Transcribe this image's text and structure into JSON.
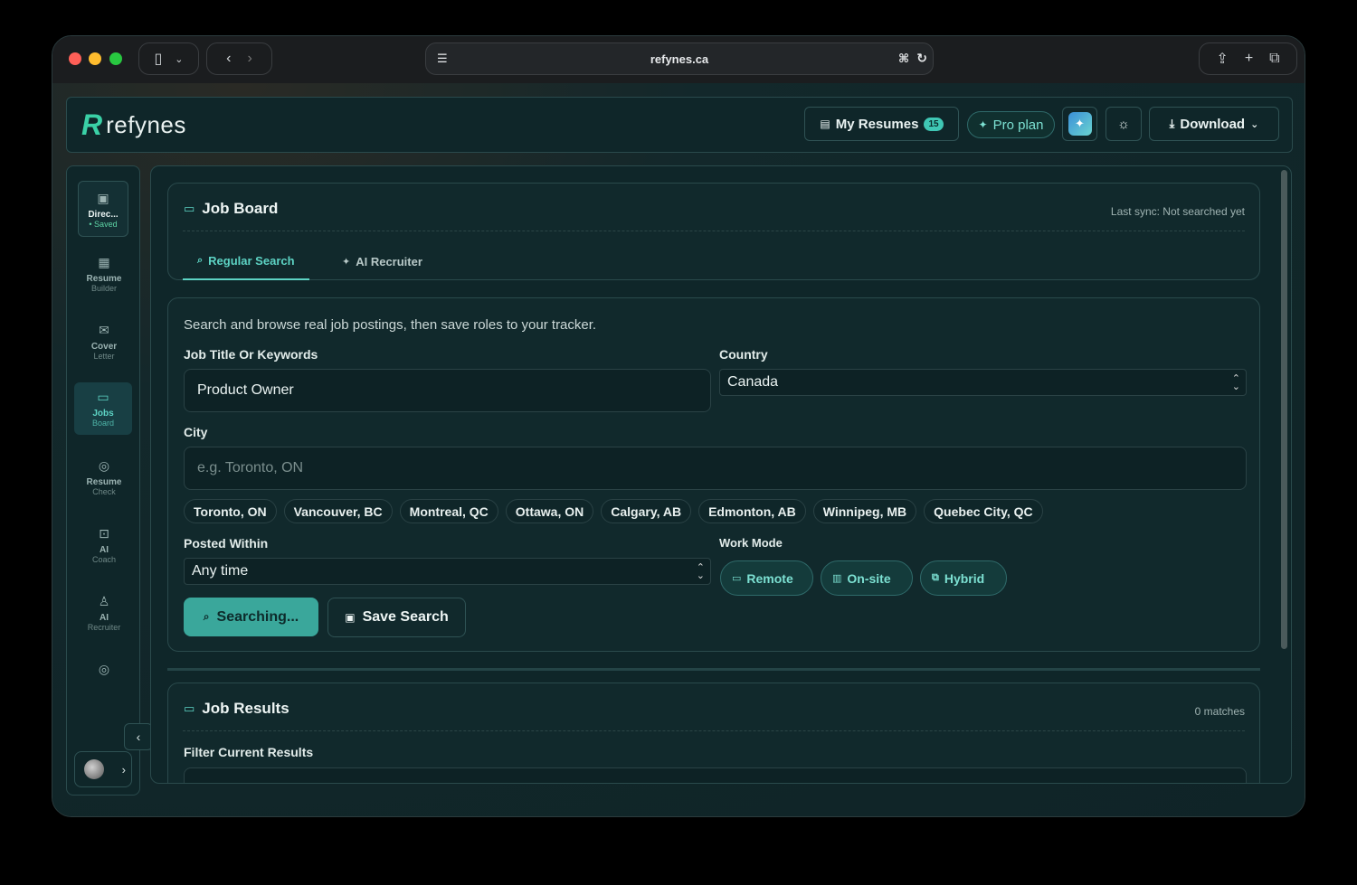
{
  "browser": {
    "url": "refynes.ca"
  },
  "header": {
    "brand": "refynes",
    "my_resumes_label": "My Resumes",
    "my_resumes_count": "15",
    "pro_plan_label": "Pro plan",
    "download_label": "Download"
  },
  "sidebar": {
    "items": [
      {
        "title": "Direc...",
        "subtitle": "• Saved",
        "icon": "save-icon"
      },
      {
        "title": "Resume",
        "subtitle": "Builder",
        "icon": "layout-icon"
      },
      {
        "title": "Cover",
        "subtitle": "Letter",
        "icon": "mail-icon"
      },
      {
        "title": "Jobs",
        "subtitle": "Board",
        "icon": "briefcase-icon"
      },
      {
        "title": "Resume",
        "subtitle": "Check",
        "icon": "target-icon"
      },
      {
        "title": "AI",
        "subtitle": "Coach",
        "icon": "bot-icon"
      },
      {
        "title": "AI",
        "subtitle": "Recruiter",
        "icon": "user-icon"
      }
    ]
  },
  "job_board": {
    "title": "Job Board",
    "last_sync": "Last sync: Not searched yet",
    "tabs": [
      {
        "label": "Regular Search",
        "active": true
      },
      {
        "label": "AI Recruiter",
        "active": false
      }
    ]
  },
  "search": {
    "description": "Search and browse real job postings, then save roles to your tracker.",
    "job_title_label": "Job Title Or Keywords",
    "job_title_value": "Product Owner",
    "country_label": "Country",
    "country_value": "Canada",
    "city_label": "City",
    "city_placeholder": "e.g. Toronto, ON",
    "city_chips": [
      "Toronto, ON",
      "Vancouver, BC",
      "Montreal, QC",
      "Ottawa, ON",
      "Calgary, AB",
      "Edmonton, AB",
      "Winnipeg, MB",
      "Quebec City, QC"
    ],
    "posted_within_label": "Posted Within",
    "posted_within_value": "Any time",
    "work_mode_label": "Work Mode",
    "work_modes": [
      "Remote",
      "On-site",
      "Hybrid"
    ],
    "search_button": "Searching...",
    "save_button": "Save Search"
  },
  "results": {
    "title": "Job Results",
    "matches": "0 matches",
    "filter_label": "Filter Current Results"
  },
  "colors": {
    "accent": "#5dd3c4",
    "background": "#0f2629"
  }
}
